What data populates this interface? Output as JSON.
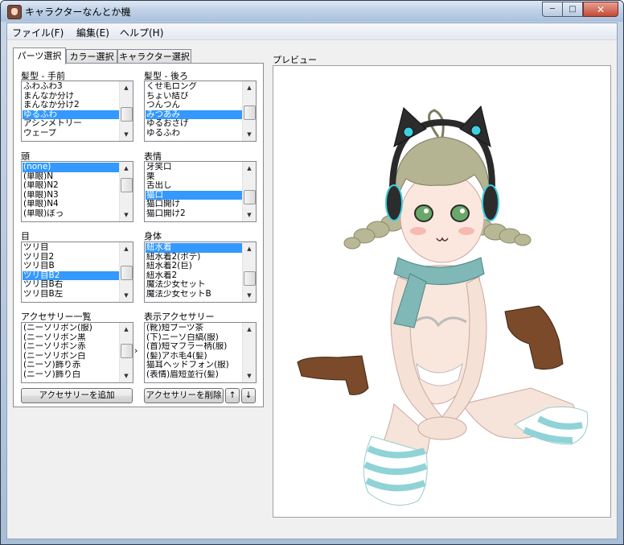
{
  "window": {
    "title": "キャラクターなんとか機",
    "min": "─",
    "max": "□",
    "close": "✕"
  },
  "menu": [
    "ファイル(F)",
    "編集(E)",
    "ヘルプ(H)"
  ],
  "tabs": [
    "パーツ選択",
    "カラー選択",
    "キャラクター選択"
  ],
  "lists": {
    "hair_front": {
      "label": "髪型 - 手前",
      "items": [
        "ふわふわ3",
        "まんなか分け",
        "まんなか分け2",
        "ゆるふわ",
        "アシンメトリー",
        "ウェーブ"
      ],
      "selected": 3,
      "thumb_pos": 0.62
    },
    "hair_back": {
      "label": "髪型 - 後ろ",
      "items": [
        "くせ毛ロング",
        "ちょい結び",
        "つんつん",
        "みつあみ",
        "ゆるおさげ",
        "ゆるふわ"
      ],
      "selected": 3,
      "thumb_pos": 0.55
    },
    "head": {
      "label": "頭",
      "items": [
        "(none)",
        "(単眼)N",
        "(単眼)N2",
        "(単眼)N3",
        "(単眼)N4",
        "(単眼)ぼっ"
      ],
      "selected": 0,
      "thumb_pos": 0.15
    },
    "expression": {
      "label": "表情",
      "items": [
        "牙笑口",
        "栗",
        "舌出し",
        "猫口",
        "猫口開け",
        "猫口開け2"
      ],
      "selected": 3,
      "thumb_pos": 0.72
    },
    "eyes": {
      "label": "目",
      "items": [
        "ツリ目",
        "ツリ目2",
        "ツリ目B",
        "ツリ目B2",
        "ツリ目B右",
        "ツリ目B左"
      ],
      "selected": 3,
      "thumb_pos": 0.5
    },
    "body": {
      "label": "身体",
      "items": [
        "紐水着",
        "紐水着2(ボテ)",
        "紐水着2(巨)",
        "紐水着2",
        "魔法少女セット",
        "魔法少女セットB"
      ],
      "selected": 0,
      "thumb_pos": 0.78
    },
    "accessories": {
      "label": "アクセサリー一覧",
      "items": [
        "(ニーソリボン(服)",
        "(ニーソリボン黒",
        "(ニーソリボン赤",
        "(ニーソリボン白",
        "(ニーソ)飾り赤",
        "(ニーソ)飾り白"
      ],
      "selected": -1,
      "thumb_pos": 0.4
    },
    "shown_accessories": {
      "label": "表示アクセサリー",
      "items": [
        "(靴)短ブーツ茶",
        "(下)ニーソ白縞(服)",
        "(首)短マフラー柄(服)",
        "(髪)アホ毛4(髪)",
        "猫耳ヘッドフォン(服)",
        "(表情)眉短並行(髪)"
      ],
      "selected": -1,
      "thumb_pos": null
    }
  },
  "buttons": {
    "add": "アクセサリーを追加",
    "remove": "アクセサリーを削除",
    "up": "↑",
    "down": "↓",
    "move": "›"
  },
  "preview": {
    "label": "プレビュー"
  },
  "colors": {
    "selection": "#3399ff",
    "scarf": "#7fb8b6",
    "hair": "#b4b392",
    "stripe": "#8fd3d6",
    "boot": "#7a4a2a",
    "headphone": "#3ecfe0"
  }
}
